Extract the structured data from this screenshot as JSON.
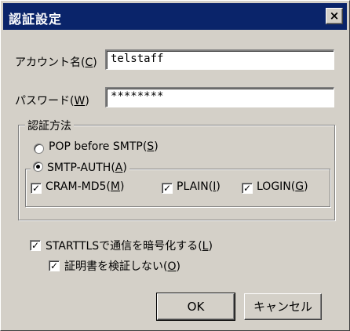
{
  "window": {
    "title": "認証設定",
    "close_symbol": "×"
  },
  "account": {
    "label": "アカウント名",
    "key": "C",
    "value": "telstaff"
  },
  "password": {
    "label": "パスワード",
    "key": "W",
    "value": "********"
  },
  "auth_group": {
    "legend": "認証方法",
    "pop_before_smtp": {
      "label": "POP before SMTP",
      "key": "S",
      "selected": false
    },
    "smtp_auth": {
      "label": "SMTP-AUTH",
      "key": "A",
      "selected": true,
      "methods": [
        {
          "label": "CRAM-MD5",
          "key": "M",
          "checked": true
        },
        {
          "label": "PLAIN",
          "key": "I",
          "checked": true
        },
        {
          "label": "LOGIN",
          "key": "G",
          "checked": true
        }
      ]
    }
  },
  "starttls": {
    "label": "STARTTLSで通信を暗号化する",
    "key": "L",
    "checked": true
  },
  "no_verify": {
    "label": "証明書を検証しない",
    "key": "O",
    "checked": true
  },
  "check_mark": "✓",
  "buttons": {
    "ok": "OK",
    "cancel": "キャンセル"
  }
}
